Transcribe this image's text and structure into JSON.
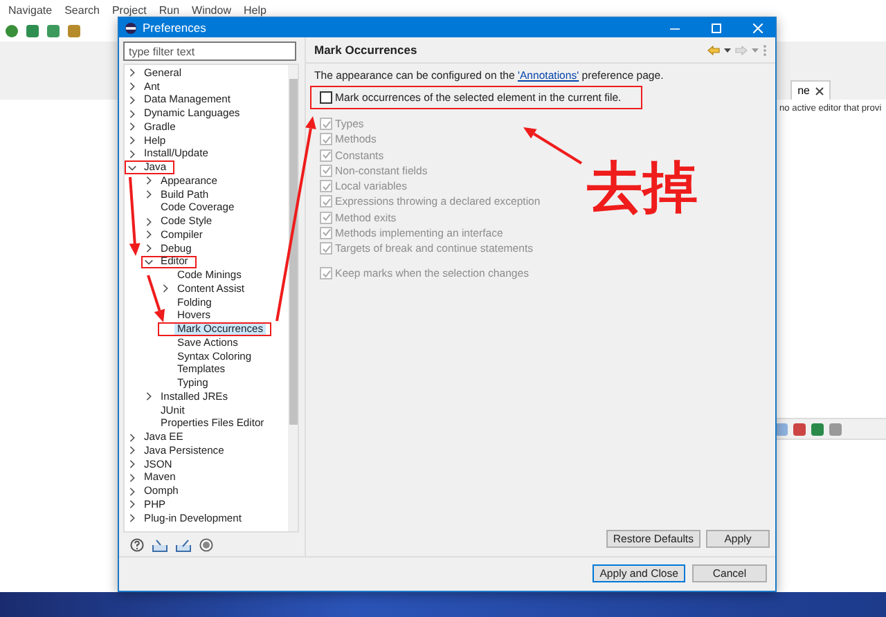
{
  "ide": {
    "menu": [
      "Navigate",
      "Search",
      "Project",
      "Run",
      "Window",
      "Help"
    ],
    "editor_tab": {
      "title": "ne"
    },
    "editor_message": "no active editor that provi"
  },
  "dialog": {
    "title": "Preferences",
    "filter": {
      "placeholder": "type filter text"
    },
    "tree": [
      {
        "label": "General",
        "expanded": false,
        "selected": false,
        "marked": false
      },
      {
        "label": "Ant",
        "expanded": false,
        "selected": false,
        "marked": false
      },
      {
        "label": "Data Management",
        "expanded": false,
        "selected": false,
        "marked": false
      },
      {
        "label": "Dynamic Languages",
        "expanded": false,
        "selected": false,
        "marked": false
      },
      {
        "label": "Gradle",
        "expanded": false,
        "selected": false,
        "marked": false
      },
      {
        "label": "Help",
        "expanded": false,
        "selected": false,
        "marked": false
      },
      {
        "label": "Install/Update",
        "expanded": false,
        "selected": false,
        "marked": false
      },
      {
        "label": "Java",
        "expanded": true,
        "selected": false,
        "marked": true,
        "children": [
          {
            "label": "Appearance",
            "expanded": false,
            "selected": false,
            "marked": false
          },
          {
            "label": "Build Path",
            "expanded": false,
            "selected": false,
            "marked": false
          },
          {
            "label": "Code Coverage",
            "selected": false,
            "marked": false
          },
          {
            "label": "Code Style",
            "expanded": false,
            "selected": false,
            "marked": false
          },
          {
            "label": "Compiler",
            "expanded": false,
            "selected": false,
            "marked": false
          },
          {
            "label": "Debug",
            "expanded": false,
            "selected": false,
            "marked": false
          },
          {
            "label": "Editor",
            "expanded": true,
            "selected": false,
            "marked": true,
            "children": [
              {
                "label": "Code Minings",
                "selected": false,
                "marked": false
              },
              {
                "label": "Content Assist",
                "expanded": false,
                "selected": false,
                "marked": false
              },
              {
                "label": "Folding",
                "selected": false,
                "marked": false
              },
              {
                "label": "Hovers",
                "selected": false,
                "marked": false
              },
              {
                "label": "Mark Occurrences",
                "selected": true,
                "marked": true
              },
              {
                "label": "Save Actions",
                "selected": false,
                "marked": false
              },
              {
                "label": "Syntax Coloring",
                "selected": false,
                "marked": false
              },
              {
                "label": "Templates",
                "selected": false,
                "marked": false
              },
              {
                "label": "Typing",
                "selected": false,
                "marked": false
              }
            ]
          },
          {
            "label": "Installed JREs",
            "expanded": false,
            "selected": false,
            "marked": false
          },
          {
            "label": "JUnit",
            "selected": false,
            "marked": false
          },
          {
            "label": "Properties Files Editor",
            "selected": false,
            "marked": false
          }
        ]
      },
      {
        "label": "Java EE",
        "expanded": false,
        "selected": false,
        "marked": false
      },
      {
        "label": "Java Persistence",
        "expanded": false,
        "selected": false,
        "marked": false
      },
      {
        "label": "JSON",
        "expanded": false,
        "selected": false,
        "marked": false
      },
      {
        "label": "Maven",
        "expanded": false,
        "selected": false,
        "marked": false
      },
      {
        "label": "Oomph",
        "expanded": false,
        "selected": false,
        "marked": false
      },
      {
        "label": "PHP",
        "expanded": false,
        "selected": false,
        "marked": false
      },
      {
        "label": "Plug-in Development",
        "expanded": false,
        "selected": false,
        "marked": false
      }
    ],
    "page": {
      "title": "Mark Occurrences",
      "description_before": "The appearance can be configured on the ",
      "link": "'Annotations'",
      "description_after": " preference page.",
      "main_option": {
        "label": "Mark occurrences of the selected element in the current file.",
        "checked": false,
        "disabled": false,
        "marked": true
      },
      "options": [
        {
          "label": "Types",
          "checked": true,
          "disabled": true
        },
        {
          "label": "Methods",
          "checked": true,
          "disabled": true
        },
        {
          "label": "Constants",
          "checked": true,
          "disabled": true
        },
        {
          "label": "Non-constant fields",
          "checked": true,
          "disabled": true
        },
        {
          "label": "Local variables",
          "checked": true,
          "disabled": true
        },
        {
          "label": "Expressions throwing a declared exception",
          "checked": true,
          "disabled": true
        },
        {
          "label": "Method exits",
          "checked": true,
          "disabled": true
        },
        {
          "label": "Methods implementing an interface",
          "checked": true,
          "disabled": true
        },
        {
          "label": "Targets of break and continue statements",
          "checked": true,
          "disabled": true
        }
      ],
      "keep_option": {
        "label": "Keep marks when the selection changes",
        "checked": true,
        "disabled": true
      },
      "buttons": [
        "Restore Defaults",
        "Apply"
      ]
    },
    "footer_buttons": [
      {
        "label": "Apply and Close",
        "default": true
      },
      {
        "label": "Cancel",
        "default": false
      }
    ]
  },
  "annotation": {
    "label": "去掉"
  }
}
